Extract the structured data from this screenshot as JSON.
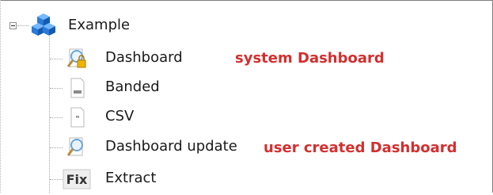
{
  "tree": {
    "root": {
      "label": "Example",
      "expanded": true,
      "icon": "cubes-icon"
    },
    "items": [
      {
        "label": "Dashboard",
        "icon": "dashboard-locked-icon",
        "annotation": "system Dashboard"
      },
      {
        "label": "Banded",
        "icon": "banded-report-icon"
      },
      {
        "label": "CSV",
        "icon": "csv-document-icon"
      },
      {
        "label": "Dashboard update",
        "icon": "dashboard-icon",
        "annotation": "user created Dashboard"
      },
      {
        "label": "Extract",
        "icon": "fix-extract-icon",
        "icon_text": "Fix"
      }
    ]
  },
  "colors": {
    "annotation": "#d32f2f",
    "cube": "#1e6fd0",
    "lock": "#f0b400"
  }
}
